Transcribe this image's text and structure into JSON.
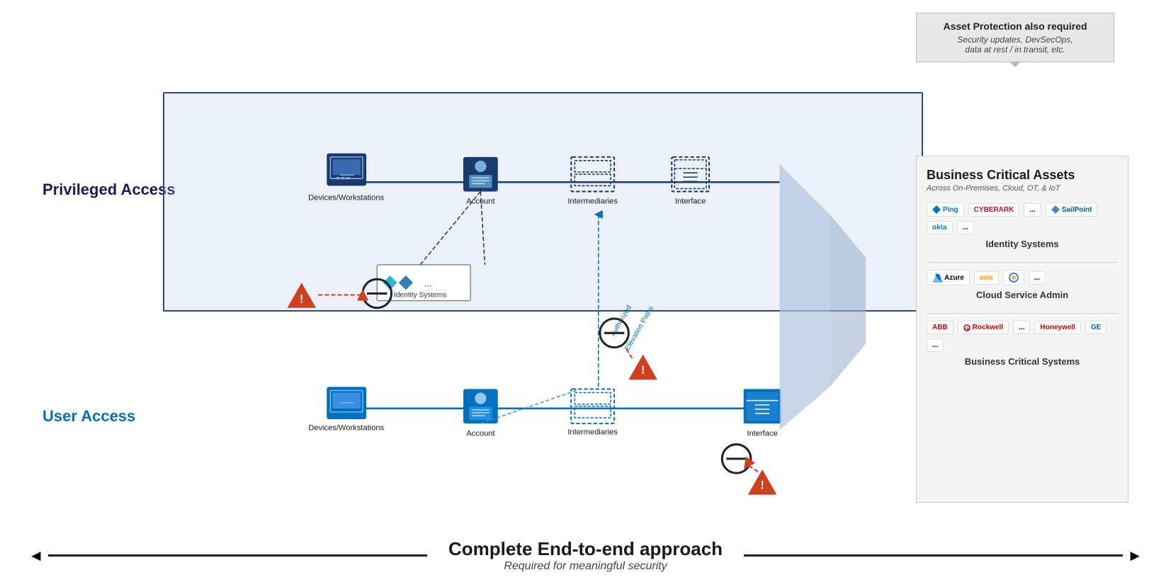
{
  "callout": {
    "title": "Asset Protection also required",
    "text": "Security updates, DevSecOps,\ndata at rest / in transit, etc."
  },
  "labels": {
    "privileged_access": "Privileged Access",
    "user_access": "User Access"
  },
  "nodes": {
    "priv_devices": "Devices/Workstations",
    "priv_account": "Account",
    "priv_intermediaries": "Intermediaries",
    "priv_interface": "Interface",
    "user_devices": "Devices/Workstations",
    "user_account": "Account",
    "user_intermediaries": "Intermediaries",
    "user_interface": "Interface",
    "identity_systems": "Identity Systems",
    "authorized_elevation": "Authorized\nElevation Paths"
  },
  "bca": {
    "title": "Business Critical Assets",
    "subtitle": "Across On-Premises, Cloud, OT, & IoT",
    "sections": [
      {
        "label": "Identity Systems",
        "logos": [
          "Ping",
          "CyberArk",
          "...",
          "SailPoint",
          "okta",
          "..."
        ]
      },
      {
        "label": "Cloud Service Admin",
        "logos": [
          "Azure",
          "aws",
          "GCP",
          "..."
        ]
      },
      {
        "label": "Business Critical Systems",
        "logos": [
          "ABB",
          "Rockwell",
          "...",
          "◆",
          "≡",
          "Honeywell",
          "GE",
          "..."
        ]
      }
    ]
  },
  "bottom": {
    "main": "Complete End-to-end approach",
    "sub": "Required for meaningful security"
  }
}
